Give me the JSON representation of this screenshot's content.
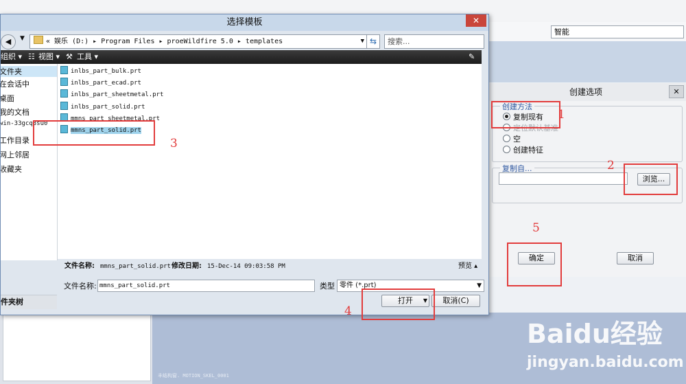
{
  "background": {
    "smart_field": "智能",
    "viewport_status": "丰结构窗. MOTION_SKEL_0001"
  },
  "file_dialog": {
    "title": "选择模板",
    "close": "✕",
    "back": "◀",
    "address": "«  娱乐 (D:) ▸ Program Files ▸ proeWildfire 5.0 ▸ templates",
    "search_placeholder": "搜索...",
    "toolbar": {
      "organize": "组织 ▾",
      "views": "视图 ▾",
      "tools": "工具 ▾"
    },
    "sidebar": [
      "文件夹",
      "在会话中",
      "桌面",
      "我的文档",
      "win-33gcq3su0",
      "工作目录",
      "网上邻居",
      "收藏夹"
    ],
    "folder_tree": "件夹树",
    "files": [
      "inlbs_part_bulk.prt",
      "inlbs_part_ecad.prt",
      "inlbs_part_sheetmetal.prt",
      "inlbs_part_solid.prt",
      "mmns_part_sheetmetal.prt",
      "mmns_part_solid.prt"
    ],
    "selected_file": "mmns_part_solid.prt",
    "detail": {
      "name_label": "文件名称:",
      "name_value": "mmns_part_solid.prt",
      "date_label": "修改日期:",
      "date_value": "15-Dec-14 09:03:58 PM",
      "preview": "预览 ▴"
    },
    "filename_label": "文件名称:",
    "filename_value": "mmns_part_solid.prt",
    "type_label": "类型",
    "type_value": "零件 (*.prt)",
    "open_label": "打开",
    "cancel_label": "取消(C)"
  },
  "create_dialog": {
    "title": "创建选项",
    "close": "✕",
    "method_legend": "创建方法",
    "options": [
      "复制现有",
      "定位默认基准",
      "空",
      "创建特征"
    ],
    "selected_option": "复制现有",
    "copy_from_legend": "复制自...",
    "browse_label": "浏览...",
    "ok_label": "确定",
    "cancel_label": "取消"
  },
  "annotations": [
    "1",
    "2",
    "3",
    "4",
    "5"
  ],
  "watermark": {
    "logo": "Baidu经验",
    "url": "jingyan.baidu.com"
  },
  "colors": {
    "annotation": "#e23b3b",
    "title_bar": "#c8d8ea",
    "selection": "#9fd3ec"
  }
}
